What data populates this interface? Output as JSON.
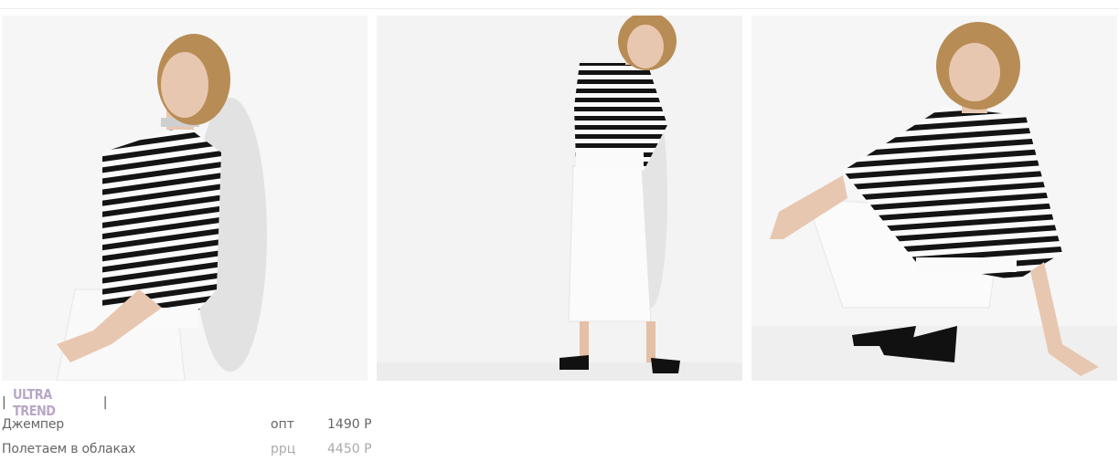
{
  "gallery": {
    "photos": [
      {
        "alt": "photo-1"
      },
      {
        "alt": "photo-2"
      },
      {
        "alt": "photo-3"
      }
    ]
  },
  "product": {
    "brand": "ULTRA TREND",
    "name_line1": "Джемпер",
    "name_line2": "Полетаем в облаках",
    "wholesale_label": "опт",
    "wholesale_price": "1490 Р",
    "retail_label": "ррц",
    "retail_price": "4450 Р"
  },
  "colors": {
    "brand_accent": "#b9a7c6",
    "text": "#666666",
    "muted": "#aaaaaa",
    "stripe_dark": "#141414"
  }
}
